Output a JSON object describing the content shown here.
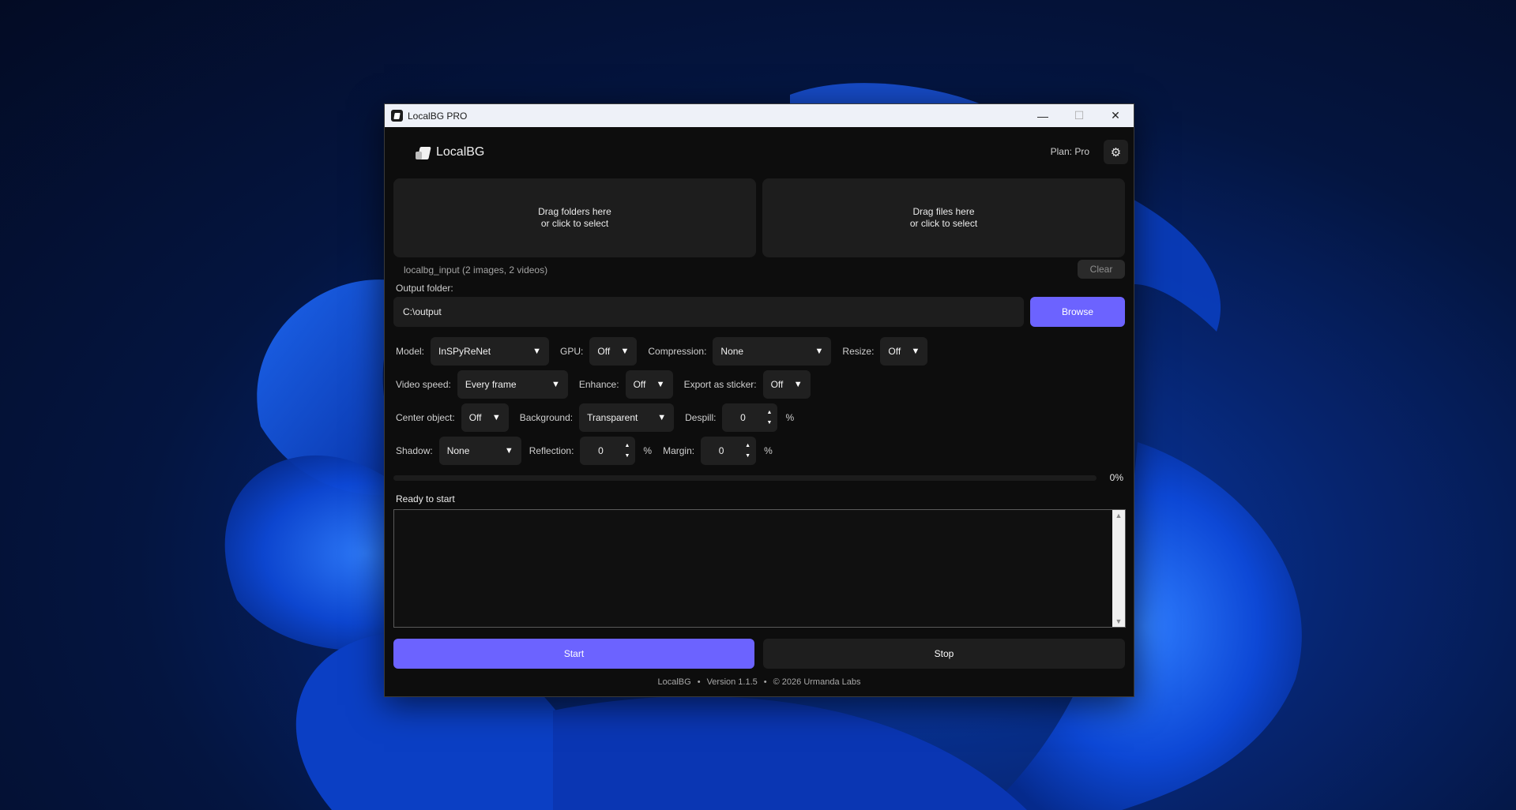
{
  "window": {
    "title": "LocalBG PRO",
    "minimize_glyph": "—",
    "maximize_glyph": "☐",
    "close_glyph": "✕"
  },
  "header": {
    "logo_text": "LocalBG",
    "plan": "Plan: Pro",
    "settings_glyph": "⚙"
  },
  "dropzones": {
    "folders_line1": "Drag folders here",
    "folders_line2": "or click to select",
    "files_line1": "Drag files here",
    "files_line2": "or click to select"
  },
  "input_info": "localbg_input (2 images, 2 videos)",
  "clear_label": "Clear",
  "output": {
    "label": "Output folder:",
    "value": "C:\\output",
    "browse_label": "Browse"
  },
  "options": {
    "model_label": "Model:",
    "model_value": "InSPyReNet",
    "gpu_label": "GPU:",
    "gpu_value": "Off",
    "compression_label": "Compression:",
    "compression_value": "None",
    "resize_label": "Resize:",
    "resize_value": "Off",
    "video_speed_label": "Video speed:",
    "video_speed_value": "Every frame",
    "enhance_label": "Enhance:",
    "enhance_value": "Off",
    "sticker_label": "Export as sticker:",
    "sticker_value": "Off",
    "center_label": "Center object:",
    "center_value": "Off",
    "background_label": "Background:",
    "background_value": "Transparent",
    "despill_label": "Despill:",
    "despill_value": "0",
    "despill_unit": "%",
    "shadow_label": "Shadow:",
    "shadow_value": "None",
    "reflection_label": "Reflection:",
    "reflection_value": "0",
    "reflection_unit": "%",
    "margin_label": "Margin:",
    "margin_value": "0",
    "margin_unit": "%"
  },
  "progress": {
    "fraction": 0,
    "label": "0%"
  },
  "status": "Ready to start",
  "start_label": "Start",
  "stop_label": "Stop",
  "footer": {
    "app": "LocalBG",
    "sep": "•",
    "version": "Version 1.1.5",
    "copyright": "© 2026 Urmanda Labs"
  },
  "colors": {
    "accent": "#6c63ff",
    "window_bg": "#0d0d0d",
    "control_bg": "#202020"
  }
}
